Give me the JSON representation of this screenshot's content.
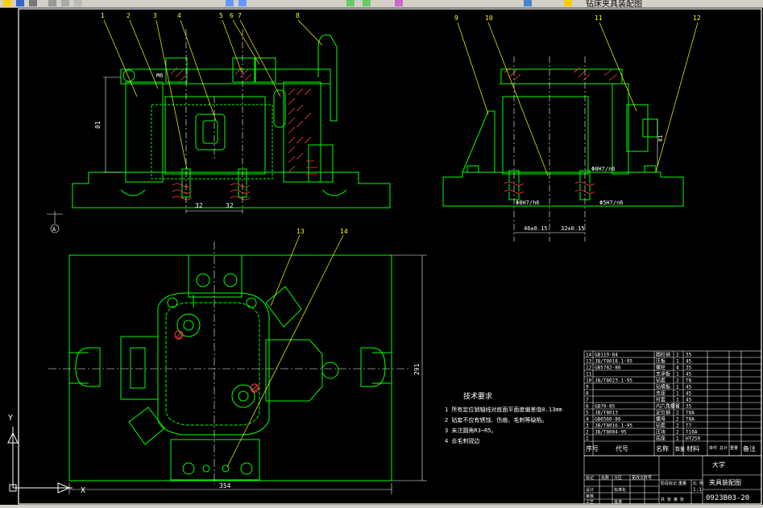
{
  "window": {
    "title": "钻床夹具装配图",
    "toolbar_icons": [
      "open-icon",
      "save-icon",
      "print-icon",
      "cut-icon",
      "copy-icon",
      "paste-icon",
      "undo-icon",
      "redo-icon",
      "pan-icon",
      "zoom-icon",
      "properties-icon",
      "layer-icon",
      "help-icon"
    ]
  },
  "colors": {
    "background": "#000000",
    "frame": "#ffffff",
    "outline": "#00ff00",
    "leader": "#ffff00",
    "section": "#ff3b3b",
    "centerline": "#ffffff",
    "ucs": "#ffffff"
  },
  "drawing": {
    "balloons_front": [
      "1",
      "2",
      "3",
      "4",
      "5",
      "6",
      "7",
      "8"
    ],
    "balloons_side": [
      "9",
      "10",
      "11",
      "12"
    ],
    "balloons_top": [
      "13",
      "14"
    ],
    "dims_front": {
      "vertical": "81",
      "bottom_left": "32",
      "bottom_right": "32",
      "hole": "M6"
    },
    "dims_side": {
      "left": "46±0.15",
      "right": "32±0.15",
      "fit1": "Φ8H7/h6",
      "fit2": "Φ5H7/n6",
      "fit3": "Φ8H7/n6",
      "height": "81"
    },
    "dims_top": {
      "width": "354",
      "height": "291"
    },
    "datum": "A",
    "ucs": {
      "x": "X",
      "y": "Y"
    }
  },
  "tech_req": {
    "title": "技术要求",
    "items": [
      "1  所有定位销轴线对底面平面度偏差值0.13mm",
      "2  钻套不应有锈蚀、伤痕、毛刺等缺陷。",
      "3  未注圆角R3~R5。",
      "4  去毛刺锐边"
    ]
  },
  "bom": {
    "rows": [
      {
        "no": "14",
        "code": "GB119-84",
        "name": "圆柱销",
        "qty": "2",
        "mat": "35"
      },
      {
        "no": "13",
        "code": "JB/T8018.1-95",
        "name": "压板",
        "qty": "1",
        "mat": "45"
      },
      {
        "no": "12",
        "code": "GB5782-86",
        "name": "螺栓",
        "qty": "4",
        "mat": "35"
      },
      {
        "no": "11",
        "code": "",
        "name": "支承板",
        "qty": "1",
        "mat": "45"
      },
      {
        "no": "10",
        "code": "JB/T8023.1-95",
        "name": "钻套",
        "qty": "2",
        "mat": "T8"
      },
      {
        "no": "9",
        "code": "",
        "name": "钻模板",
        "qty": "1",
        "mat": "45"
      },
      {
        "no": "8",
        "code": "",
        "name": "支座",
        "qty": "1",
        "mat": "45"
      },
      {
        "no": "7",
        "code": "",
        "name": "衬套",
        "qty": "1",
        "mat": "45"
      },
      {
        "no": "6",
        "code": "GB70-85",
        "name": "内六角螺钉",
        "qty": "4",
        "mat": "35"
      },
      {
        "no": "5",
        "code": "JB/T8013",
        "name": "定位销",
        "qty": "2",
        "mat": "T8A"
      },
      {
        "no": "4",
        "code": "GB6560-86",
        "name": "螺母",
        "qty": "2",
        "mat": "T8A"
      },
      {
        "no": "3",
        "code": "JB/T8016.1-95",
        "name": "钻套",
        "qty": "2",
        "mat": "T7"
      },
      {
        "no": "2",
        "code": "JB/T8004-95",
        "name": "压块",
        "qty": "2",
        "mat": "T10A"
      },
      {
        "no": "1",
        "code": "",
        "name": "底座",
        "qty": "1",
        "mat": "HT250"
      }
    ],
    "header": {
      "no": "序号",
      "code": "代号",
      "name": "名称",
      "qty": "数量",
      "mat": "材料",
      "weight": "单件 总计 重量",
      "remark": "备注"
    }
  },
  "title_block": {
    "school": "大学",
    "drawing_name": "夹具装配图",
    "drawing_no": "0923B03-20",
    "scale_label": "比 例",
    "scale": "1:1",
    "sheet": "共 张 第 张",
    "labels": [
      "标记",
      "处数",
      "分区",
      "更改文件号",
      "签名",
      "年月日",
      "设计",
      "标准化",
      "审核",
      "工艺",
      "批准"
    ],
    "weight_label": "重量",
    "stage_label": "阶段标记"
  }
}
